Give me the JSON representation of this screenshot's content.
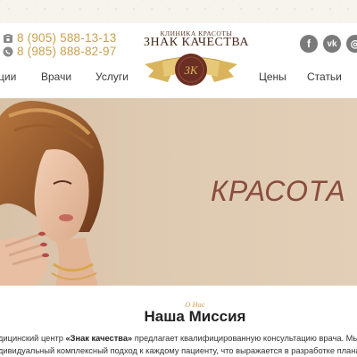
{
  "header": {
    "phones": [
      "8 (905) 588-13-13",
      "8 (985) 888-82-97"
    ],
    "logo_small": "КЛИНИКА КРАСОТЫ",
    "logo_main": "ЗНАК КАЧЕСТВА",
    "emblem_monogram": "ЗК",
    "social": [
      {
        "name": "facebook-icon",
        "glyph": "f"
      },
      {
        "name": "vk-icon",
        "glyph": "vk"
      },
      {
        "name": "instagram-icon",
        "glyph": "◎"
      }
    ]
  },
  "nav": {
    "items": [
      "ции",
      "Врачи",
      "Услуги",
      "Цены",
      "Статьи"
    ]
  },
  "hero": {
    "word": "КРАСОТА"
  },
  "mission": {
    "eyebrow": "О Нас",
    "title": "Наша Миссия",
    "line1_pre": "дицинский центр ",
    "line1_brand": "«Знак качества»",
    "line1_post": " предлагает квалифицированную консультацию врача. Мы осуществл",
    "line2": "дивидуальный комплексный подход к каждому пациенту, что выражается в разработке плана лечения,"
  },
  "colors": {
    "accent_gold": "#c9a04d",
    "brand_brown": "#6a2e22",
    "hero_bg": "#dec9b1",
    "hero_text": "#8a4c3c",
    "social_grey": "#7a7a7a"
  }
}
